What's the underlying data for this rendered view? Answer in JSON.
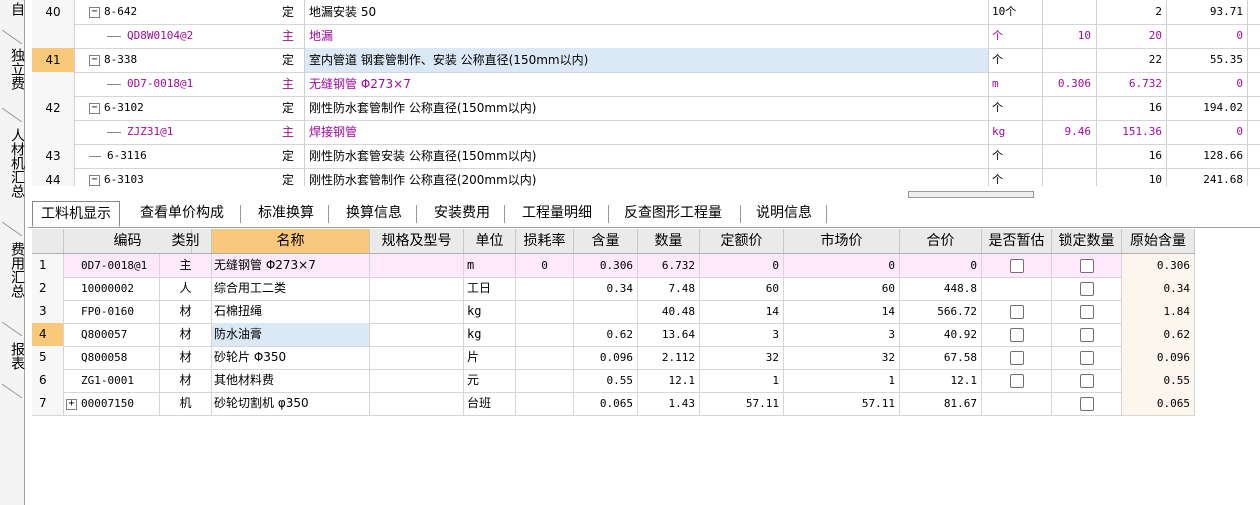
{
  "left_nav": [
    "自",
    "独立费",
    "人材机汇总",
    "费用汇总",
    "报表"
  ],
  "top_rows": [
    {
      "no": "40",
      "code": "8-642",
      "type": "定",
      "name": "地漏安装 50",
      "unit": "10个",
      "loss": "",
      "qty": "2",
      "price": "93.71",
      "kind": "parent",
      "sign": "−"
    },
    {
      "no": "",
      "code": "QD8W0104@2",
      "type": "主",
      "name": "地漏",
      "unit": "个",
      "loss": "10",
      "qty": "20",
      "price": "0",
      "kind": "child"
    },
    {
      "no": "41",
      "code": "8-338",
      "type": "定",
      "name": "室内管道 钢套管制作、安装 公称直径(150mm以内)",
      "unit": "个",
      "loss": "",
      "qty": "22",
      "price": "55.35",
      "kind": "parent",
      "sign": "−"
    },
    {
      "no": "",
      "code": "0D7-0018@1",
      "type": "主",
      "name": "无缝钢管 Φ273×7",
      "unit": "m",
      "loss": "0.306",
      "qty": "6.732",
      "price": "0",
      "kind": "child"
    },
    {
      "no": "42",
      "code": "6-3102",
      "type": "定",
      "name": "刚性防水套管制作 公称直径(150mm以内)",
      "unit": "个",
      "loss": "",
      "qty": "16",
      "price": "194.02",
      "kind": "parent",
      "sign": "−"
    },
    {
      "no": "",
      "code": "ZJZ31@1",
      "type": "主",
      "name": "焊接钢管",
      "unit": "kg",
      "loss": "9.46",
      "qty": "151.36",
      "price": "0",
      "kind": "child"
    },
    {
      "no": "43",
      "code": "6-3116",
      "type": "定",
      "name": "刚性防水套管安装 公称直径(150mm以内)",
      "unit": "个",
      "loss": "",
      "qty": "16",
      "price": "128.66",
      "kind": "leaf"
    },
    {
      "no": "44",
      "code": "6-3103",
      "type": "定",
      "name": "刚性防水套管制作 公称直径(200mm以内)",
      "unit": "个",
      "loss": "",
      "qty": "10",
      "price": "241.68",
      "kind": "parent",
      "sign": "−"
    }
  ],
  "tabs": [
    "工料机显示",
    "查看单价构成",
    "标准换算",
    "换算信息",
    "安装费用",
    "工程量明细",
    "反查图形工程量",
    "说明信息"
  ],
  "columns": [
    "编码",
    "类别",
    "名称",
    "规格及型号",
    "单位",
    "损耗率",
    "含量",
    "数量",
    "定额价",
    "市场价",
    "合价",
    "是否暂估",
    "锁定数量",
    "原始含量"
  ],
  "rows": [
    {
      "no": "1",
      "code": "0D7-0018@1",
      "type": "主",
      "name": "无缝钢管 Φ273×7",
      "spec": "",
      "unit": "m",
      "loss": "0",
      "content": "0.306",
      "qty": "6.732",
      "quota": "0",
      "market": "0",
      "total": "0",
      "est": true,
      "lock": true,
      "orig": "0.306"
    },
    {
      "no": "2",
      "code": "10000002",
      "type": "人",
      "name": "综合用工二类",
      "spec": "",
      "unit": "工日",
      "loss": "",
      "content": "0.34",
      "qty": "7.48",
      "quota": "60",
      "market": "60",
      "total": "448.8",
      "est": false,
      "lock": true,
      "orig": "0.34"
    },
    {
      "no": "3",
      "code": "FP0-0160",
      "type": "材",
      "name": "石棉扭绳",
      "spec": "",
      "unit": "kg",
      "loss": "",
      "content": "",
      "qty": "40.48",
      "quota": "14",
      "market": "14",
      "total": "566.72",
      "est": true,
      "lock": true,
      "orig": "1.84"
    },
    {
      "no": "4",
      "code": "Q800057",
      "type": "材",
      "name": "防水油膏",
      "spec": "",
      "unit": "kg",
      "loss": "",
      "content": "0.62",
      "qty": "13.64",
      "quota": "3",
      "market": "3",
      "total": "40.92",
      "est": true,
      "lock": true,
      "orig": "0.62"
    },
    {
      "no": "5",
      "code": "Q800058",
      "type": "材",
      "name": "砂轮片 Φ350",
      "spec": "",
      "unit": "片",
      "loss": "",
      "content": "0.096",
      "qty": "2.112",
      "quota": "32",
      "market": "32",
      "total": "67.58",
      "est": true,
      "lock": true,
      "orig": "0.096"
    },
    {
      "no": "6",
      "code": "ZG1-0001",
      "type": "材",
      "name": "其他材料费",
      "spec": "",
      "unit": "元",
      "loss": "",
      "content": "0.55",
      "qty": "12.1",
      "quota": "1",
      "market": "1",
      "total": "12.1",
      "est": true,
      "lock": true,
      "orig": "0.55"
    },
    {
      "no": "7",
      "code": "00007150",
      "type": "机",
      "name": "砂轮切割机 φ350",
      "spec": "",
      "unit": "台班",
      "loss": "",
      "content": "0.065",
      "qty": "1.43",
      "quota": "57.11",
      "market": "57.11",
      "total": "81.67",
      "est": false,
      "lock": true,
      "orig": "0.065"
    }
  ]
}
